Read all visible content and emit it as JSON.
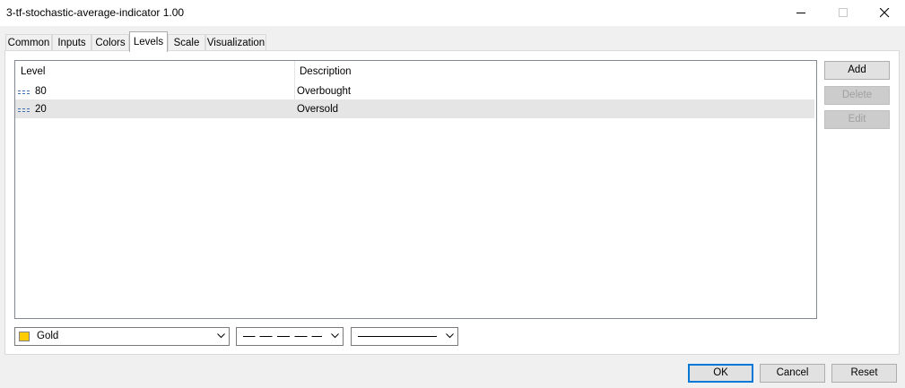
{
  "window": {
    "title": "3-tf-stochastic-average-indicator 1.00"
  },
  "tabs": [
    {
      "label": "Common",
      "active": false
    },
    {
      "label": "Inputs",
      "active": false
    },
    {
      "label": "Colors",
      "active": false
    },
    {
      "label": "Levels",
      "active": true
    },
    {
      "label": "Scale",
      "active": false
    },
    {
      "label": "Visualization",
      "active": false
    }
  ],
  "levels_table": {
    "columns": [
      "Level",
      "Description"
    ],
    "rows": [
      {
        "level": "80",
        "description": "Overbought",
        "selected": false
      },
      {
        "level": "20",
        "description": "Oversold",
        "selected": true
      }
    ]
  },
  "side_buttons": {
    "add": "Add",
    "delete": "Delete",
    "edit": "Edit"
  },
  "style": {
    "color_label": "Gold",
    "color_hex": "#FFCC00"
  },
  "footer": {
    "ok": "OK",
    "cancel": "Cancel",
    "reset": "Reset"
  }
}
